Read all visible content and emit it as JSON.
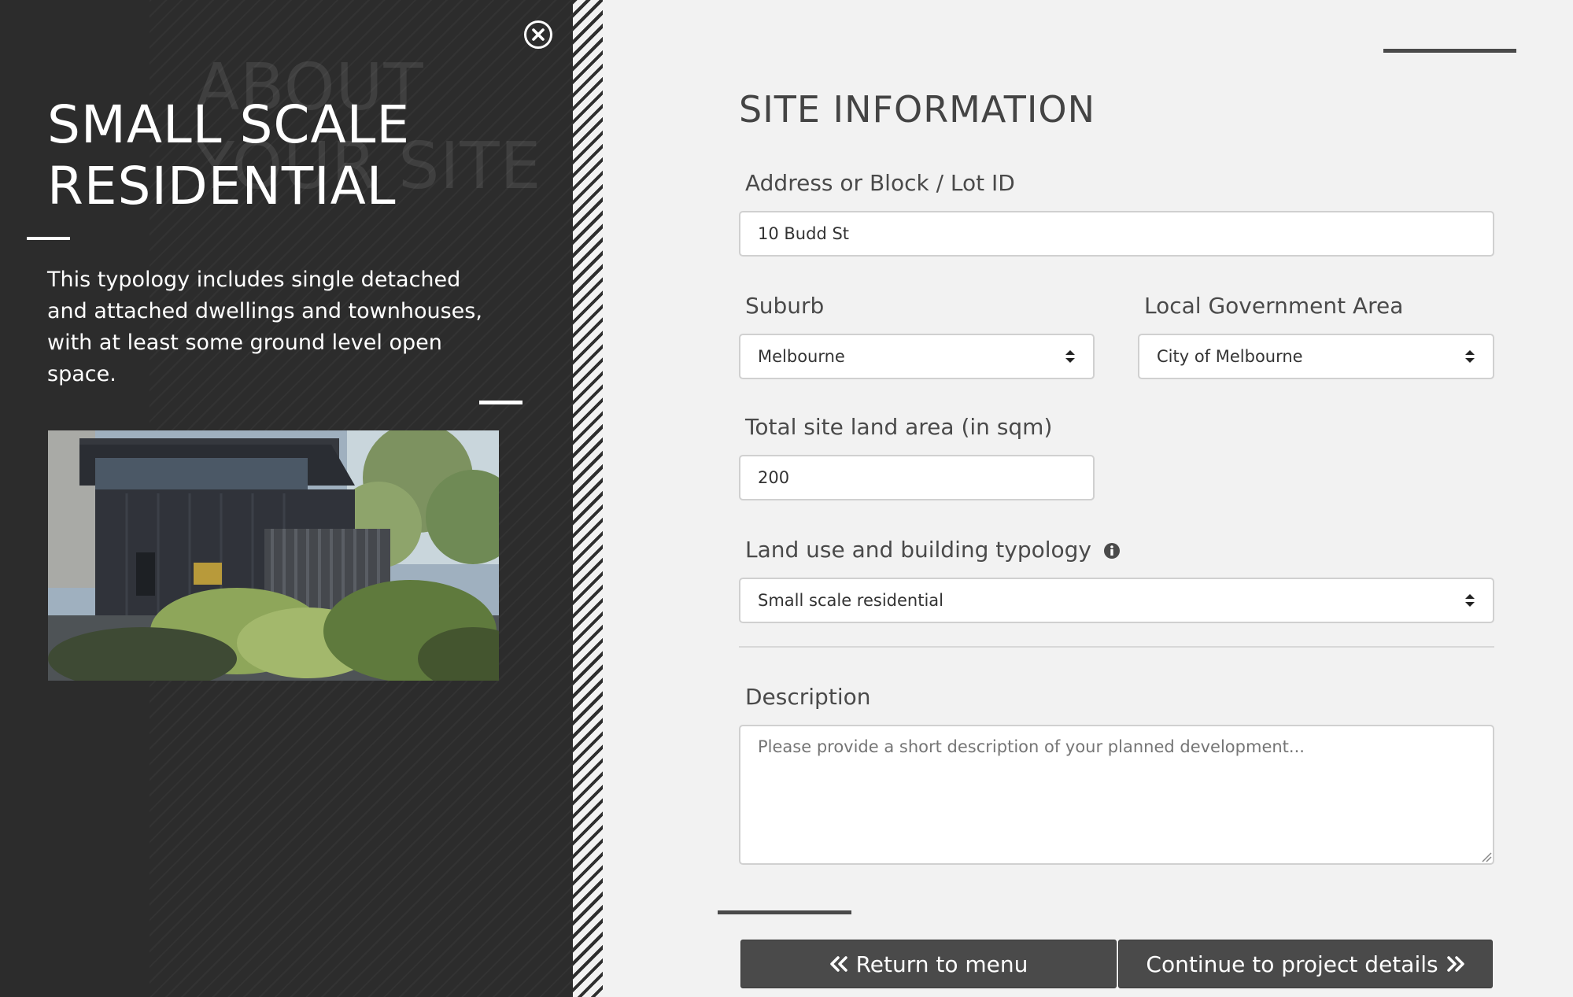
{
  "panel": {
    "title_line1": "SMALL SCALE",
    "title_line2": "RESIDENTIAL",
    "description": "This typology includes single detached and attached dwellings and townhouses, with at least some ground level open space.",
    "photo_alt": "Small scale residential building with dark cladding and garden",
    "close_icon": "close-circle-icon"
  },
  "form": {
    "title": "SITE INFORMATION",
    "address": {
      "label": "Address or Block / Lot ID",
      "value": "10 Budd St"
    },
    "suburb": {
      "label": "Suburb",
      "value": "Melbourne"
    },
    "lga": {
      "label": "Local Government Area",
      "value": "City of Melbourne"
    },
    "land_area": {
      "label": "Total site land area (in sqm)",
      "value": "200"
    },
    "typology": {
      "label": "Land use and building typology",
      "value": "Small scale residential",
      "info_icon": "info-icon"
    },
    "description": {
      "label": "Description",
      "placeholder": "Please provide a short description of your planned development..."
    }
  },
  "buttons": {
    "return_label": "Return to menu",
    "continue_label": "Continue to project details"
  }
}
